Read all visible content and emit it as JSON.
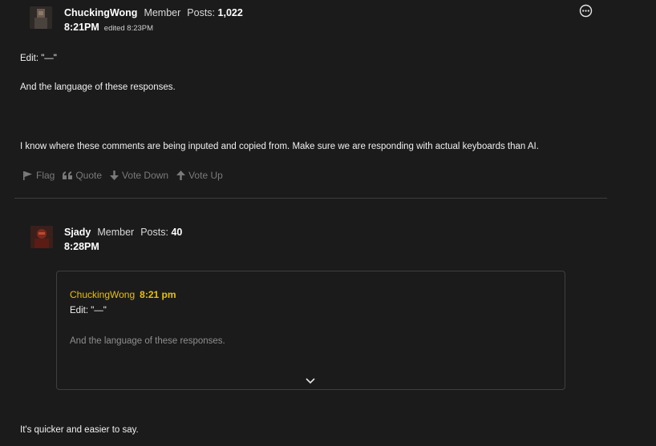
{
  "post1": {
    "username": "ChuckingWong",
    "role": "Member",
    "posts_label": "Posts:",
    "posts_count": "1,022",
    "time": "8:21PM",
    "edited": "edited 8:23PM",
    "line1": "Edit: \"—\"",
    "line2": "And the language of these responses.",
    "line3": "I know where these comments are being inputed and copied from. Make sure we are responding with actual keyboards than AI.",
    "actions": {
      "flag": "Flag",
      "quote": "Quote",
      "vote_down": "Vote Down",
      "vote_up": "Vote Up"
    }
  },
  "post2": {
    "username": "Sjady",
    "role": "Member",
    "posts_label": "Posts:",
    "posts_count": "40",
    "time": "8:28PM",
    "quote": {
      "author": "ChuckingWong",
      "time": "8:21 pm",
      "line1": "Edit: \"—\"",
      "line2": "And the language of these responses."
    },
    "body": "It's quicker and easier to say."
  }
}
